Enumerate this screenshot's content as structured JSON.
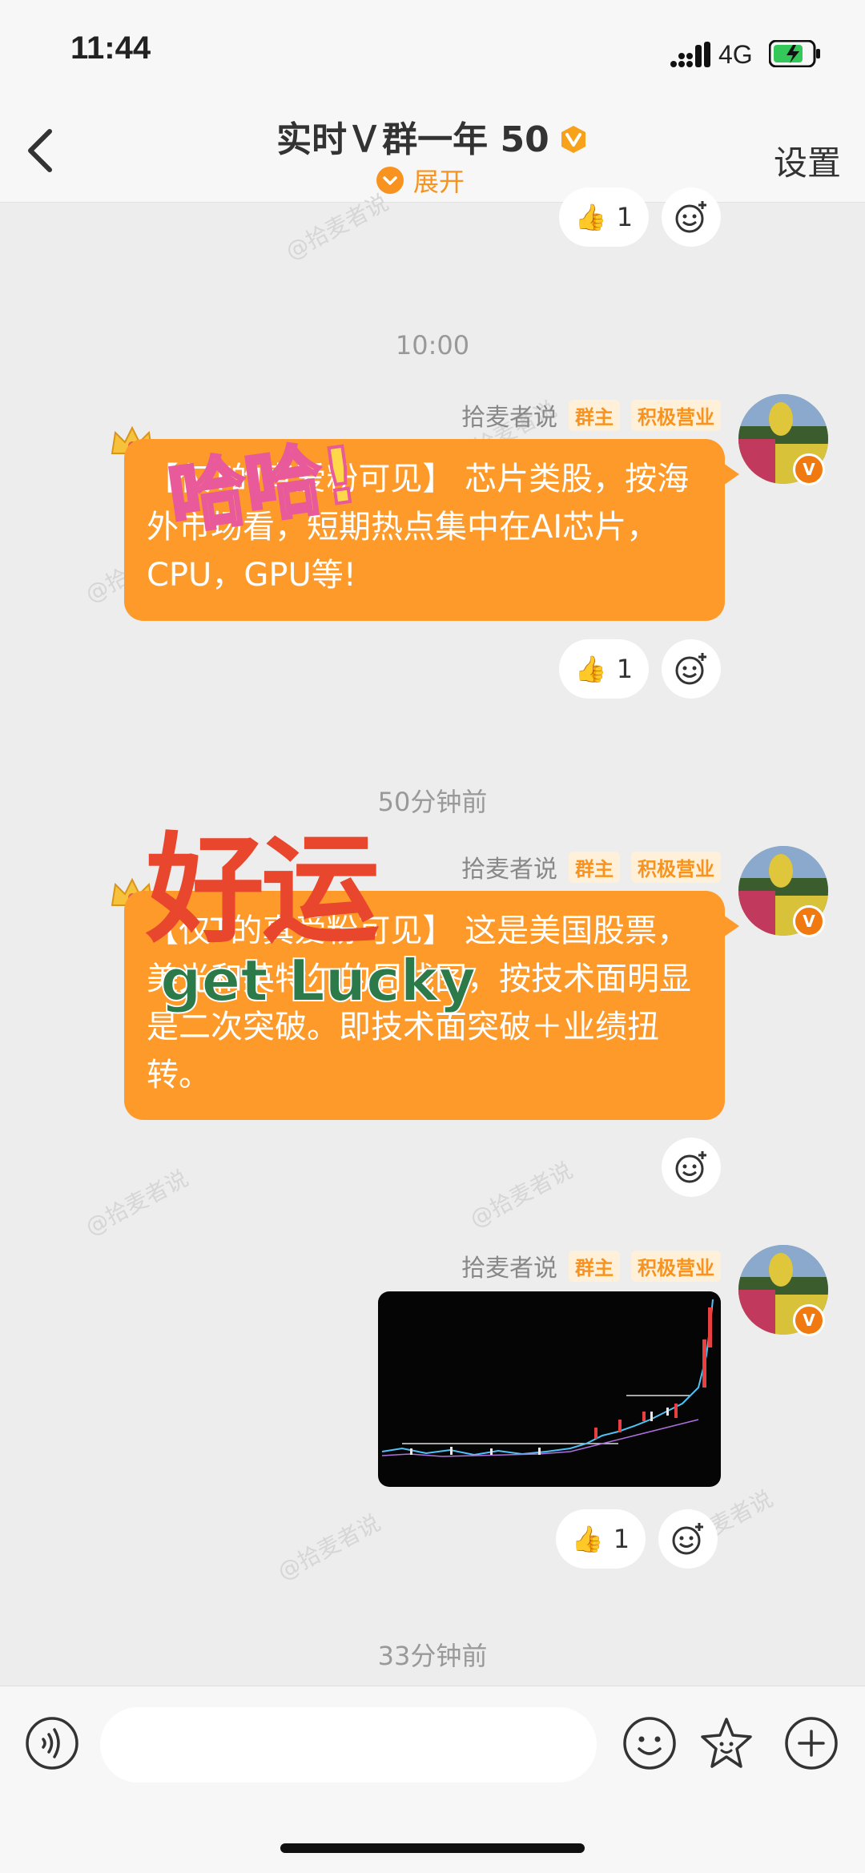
{
  "status_bar": {
    "time": "11:44",
    "network": "4G"
  },
  "header": {
    "title": "实时Ｖ群一年 50",
    "expand_label": "展开",
    "settings_label": "设置"
  },
  "watermark": "@拾麦者说",
  "messages": [
    {
      "reactions": {
        "like_count": "1"
      }
    },
    {
      "timestamp": "10:00",
      "sender": "拾麦者说",
      "tags": [
        "群主",
        "积极营业"
      ],
      "text": "【仅T的真爱粉可见】 芯片类股，按海外市场看，短期热点集中在AI芯片，CPU，GPU等!",
      "sticker": "哈哈!",
      "reactions": {
        "like_count": "1"
      }
    },
    {
      "timestamp": "50分钟前",
      "sender": "拾麦者说",
      "tags": [
        "群主",
        "积极营业"
      ],
      "text": "【仅T的真爱粉可见】 这是美国股票，美光和英特尔的周线图，按技术面明显是二次突破。即技术面突破＋业绩扭转。",
      "sticker_main": "好运",
      "sticker_sub": "get Lucky"
    },
    {
      "sender": "拾麦者说",
      "tags": [
        "群主",
        "积极营业"
      ],
      "image": "stock-chart",
      "reactions": {
        "like_count": "1"
      }
    },
    {
      "timestamp": "33分钟前"
    }
  ],
  "colors": {
    "accent": "#f7931e",
    "bubble": "#fd9a2a"
  },
  "input": {
    "placeholder": ""
  }
}
